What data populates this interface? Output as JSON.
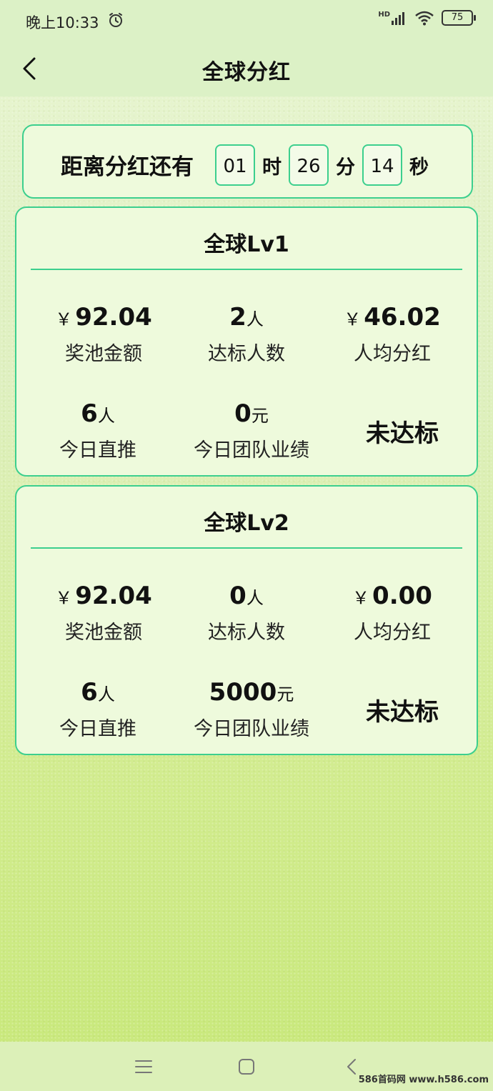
{
  "status_bar": {
    "time": "晚上10:33",
    "battery": "75",
    "network": "HD"
  },
  "header": {
    "title": "全球分红"
  },
  "countdown": {
    "label": "距离分红还有",
    "hours": "01",
    "hours_unit": "时",
    "minutes": "26",
    "minutes_unit": "分",
    "seconds": "14",
    "seconds_unit": "秒"
  },
  "levels": [
    {
      "title": "全球Lv1",
      "pool": {
        "prefix": "￥",
        "value": "92.04",
        "label": "奖池金额"
      },
      "qualified": {
        "value": "2",
        "suffix": "人",
        "label": "达标人数"
      },
      "avg": {
        "prefix": "￥",
        "value": "46.02",
        "label": "人均分红"
      },
      "direct": {
        "value": "6",
        "suffix": "人",
        "label": "今日直推"
      },
      "team": {
        "value": "0",
        "suffix": "元",
        "label": "今日团队业绩"
      },
      "status": "未达标"
    },
    {
      "title": "全球Lv2",
      "pool": {
        "prefix": "￥",
        "value": "92.04",
        "label": "奖池金额"
      },
      "qualified": {
        "value": "0",
        "suffix": "人",
        "label": "达标人数"
      },
      "avg": {
        "prefix": "￥",
        "value": "0.00",
        "label": "人均分红"
      },
      "direct": {
        "value": "6",
        "suffix": "人",
        "label": "今日直推"
      },
      "team": {
        "value": "5000",
        "suffix": "元",
        "label": "今日团队业绩"
      },
      "status": "未达标"
    }
  ],
  "watermark": "586首码网 www.h586.com",
  "colors": {
    "accent": "#3ccf8e",
    "card_bg": "#eefadc",
    "bar_bg": "#dcf1c6"
  },
  "icons": {
    "back": "chevron-left-icon",
    "alarm": "alarm-icon",
    "menu": "menu-icon",
    "home": "home-icon",
    "nav_back": "nav-back-icon"
  }
}
